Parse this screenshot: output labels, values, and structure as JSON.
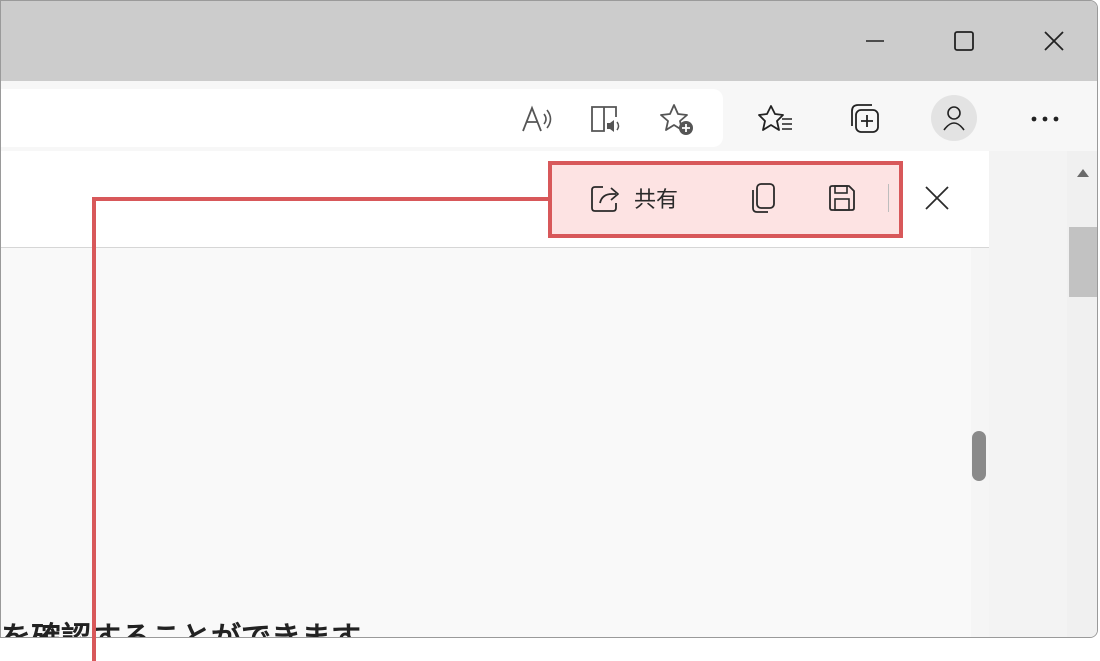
{
  "window_controls": {
    "minimize": "minimize-icon",
    "maximize": "maximize-icon",
    "close": "close-icon"
  },
  "toolbar": {
    "icons": [
      "read-aloud-icon",
      "immersive-reader-icon",
      "add-favorite-icon",
      "favorites-icon",
      "collections-icon",
      "profile-icon",
      "more-icon"
    ]
  },
  "screenshot_panel": {
    "share_label": "共有",
    "icons": [
      "share-icon",
      "copy-icon",
      "save-icon",
      "close-icon"
    ]
  },
  "document": {
    "partial_text": "を確認することができます"
  },
  "colors": {
    "highlight_border": "#d8585a",
    "highlight_fill": "#fde3e3",
    "titlebar": "#cccccc"
  }
}
